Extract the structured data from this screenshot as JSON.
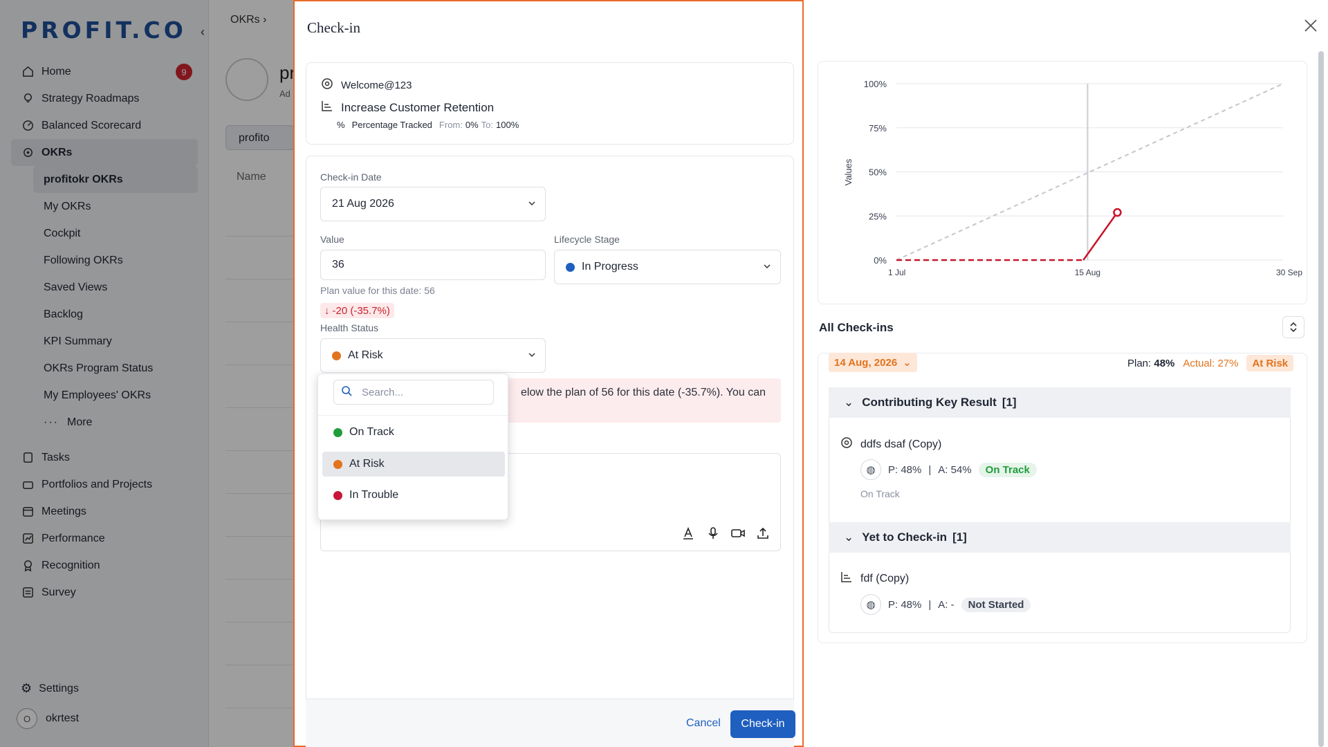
{
  "brand": {
    "logo_text": "PROFIT.CO"
  },
  "sidebar": {
    "home": {
      "label": "Home",
      "badge": "9"
    },
    "items": [
      {
        "label": "Strategy Roadmaps"
      },
      {
        "label": "Balanced Scorecard"
      },
      {
        "label": "OKRs"
      }
    ],
    "okr_sub": [
      "profitokr OKRs",
      "My OKRs",
      "Cockpit",
      "Following OKRs",
      "Saved Views",
      "Backlog",
      "KPI Summary",
      "OKRs Program Status",
      "My Employees' OKRs"
    ],
    "more": "More",
    "lower": [
      "Tasks",
      "Portfolios and Projects",
      "Meetings",
      "Performance",
      "Recognition",
      "Survey"
    ],
    "settings": "Settings",
    "user": {
      "initial": "O",
      "name": "okrtest"
    }
  },
  "background": {
    "breadcrumb": "OKRs",
    "title_fragment": "pr",
    "sub_fragment": "Ad",
    "chip": "profito",
    "column": "Name"
  },
  "modal": {
    "title": "Check-in",
    "kr": {
      "owner": "Welcome@123",
      "name": "Increase Customer Retention",
      "tracking": "Percentage Tracked",
      "from_label": "From:",
      "from_value": "0%",
      "to_label": "To:",
      "to_value": "100%"
    },
    "checkin_date": {
      "label": "Check-in Date",
      "value": "21 Aug 2026"
    },
    "value": {
      "label": "Value",
      "value": "36"
    },
    "lifecycle": {
      "label": "Lifecycle Stage",
      "value": "In Progress"
    },
    "plan_hint": "Plan value for this date: 56",
    "delta": "-20 (-35.7%)",
    "health": {
      "label": "Health Status",
      "value": "At Risk"
    },
    "alert_text": "elow the plan of 56 for this date (-35.7%). You can",
    "dropdown": {
      "placeholder": "Search...",
      "options": [
        "On Track",
        "At Risk",
        "In Trouble"
      ]
    },
    "cancel": "Cancel",
    "submit": "Check-in"
  },
  "chart_data": {
    "type": "line",
    "ylabel": "Values",
    "y_ticks": [
      "100%",
      "75%",
      "50%",
      "25%",
      "0%"
    ],
    "x_ticks": [
      "1 Jul",
      "15 Aug",
      "30 Sep"
    ],
    "ylim": [
      0,
      100
    ],
    "series": [
      {
        "style": "plan-dashed-grey",
        "points": [
          [
            "1 Jul",
            0
          ],
          [
            "30 Sep",
            100
          ]
        ]
      },
      {
        "style": "actual-dashed-red",
        "points": [
          [
            "1 Jul",
            0
          ],
          [
            "14 Aug",
            0
          ]
        ]
      },
      {
        "style": "actual-solid-red",
        "points": [
          [
            "14 Aug",
            0
          ],
          [
            "22 Aug",
            27
          ]
        ]
      }
    ],
    "current_marker": "15 Aug"
  },
  "checkins": {
    "title": "All Check-ins",
    "date": "14 Aug, 2026",
    "plan_label": "Plan:",
    "plan_value": "48%",
    "actual_label": "Actual:",
    "actual_value": "27%",
    "status": "At Risk",
    "sections": [
      {
        "title": "Contributing Key Result",
        "count": "[1]",
        "item": {
          "name": "ddfs dsaf (Copy)",
          "plan": "P: 48%",
          "actual": "A: 54%",
          "status": "On Track",
          "note": "On Track"
        }
      },
      {
        "title": "Yet to Check-in",
        "count": "[1]",
        "item": {
          "name": "fdf (Copy)",
          "plan": "P: 48%",
          "actual": "A: -",
          "status": "Not Started"
        }
      }
    ]
  },
  "colors": {
    "primary": "#1f5fbf",
    "at_risk": "#e2731f",
    "on_track": "#1f9d3a",
    "in_trouble": "#c8173a",
    "in_progress": "#1f5fbf",
    "modal_border": "#ea6a2a"
  }
}
